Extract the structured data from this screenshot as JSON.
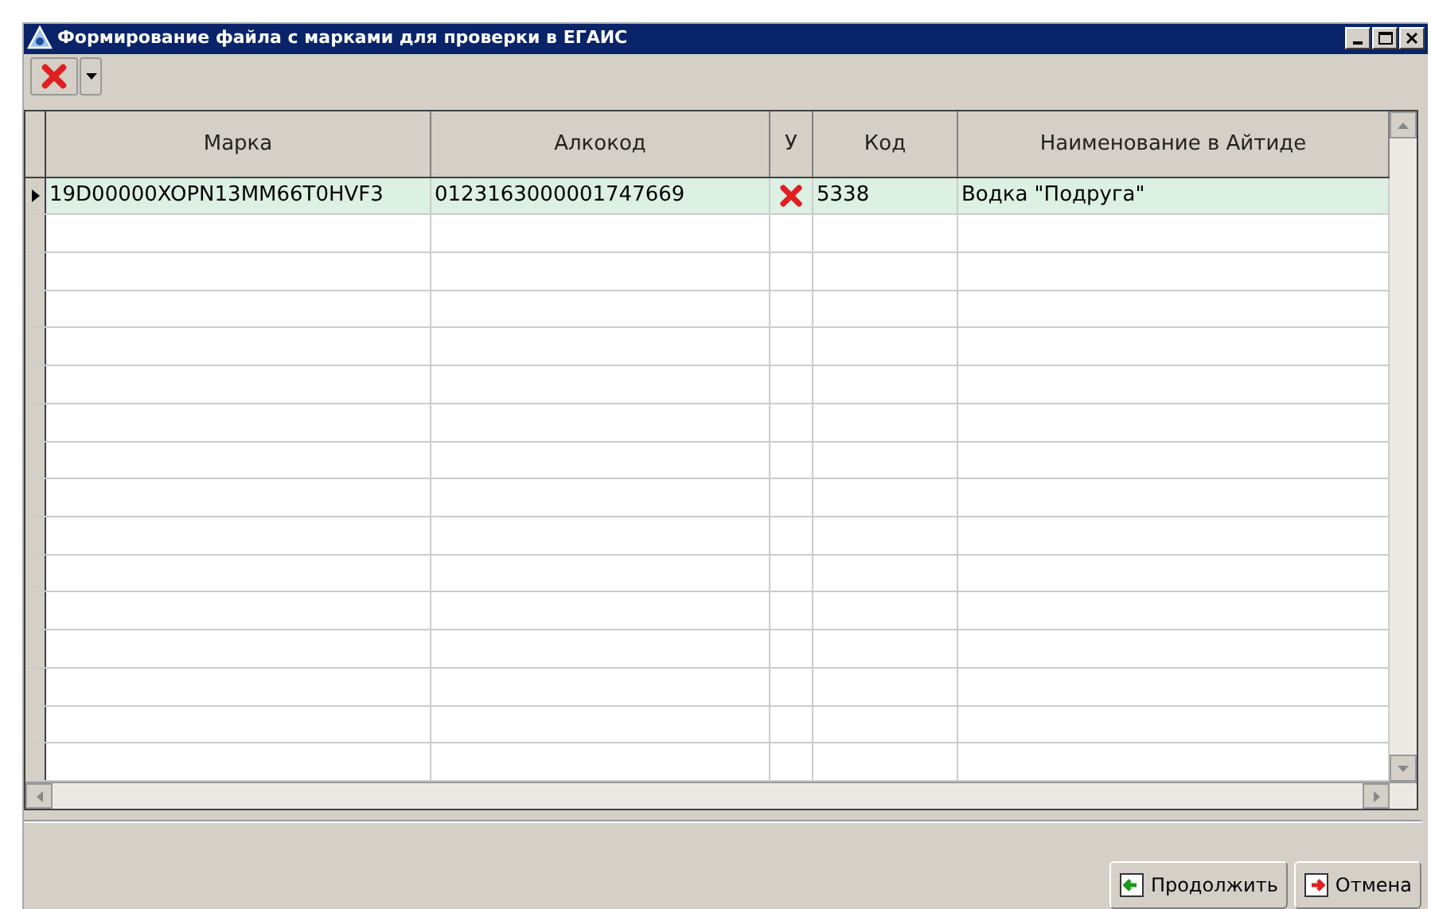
{
  "window": {
    "title": "Формирование файла с марками для проверки в ЕГАИС"
  },
  "table": {
    "columns": [
      "Марка",
      "Алкокод",
      "У",
      "Код",
      "Наименование в Айтиде"
    ],
    "rows": [
      {
        "selected": true,
        "rejected": true,
        "cells": [
          "19D00000XOPN13MM66T0HVF3",
          "0123163000001747669",
          "",
          "5338",
          "Водка \"Подруга\""
        ]
      }
    ]
  },
  "buttons": [
    {
      "kind": "continue",
      "label": "Продолжить"
    },
    {
      "kind": "cancel",
      "label": "Отмена"
    }
  ]
}
